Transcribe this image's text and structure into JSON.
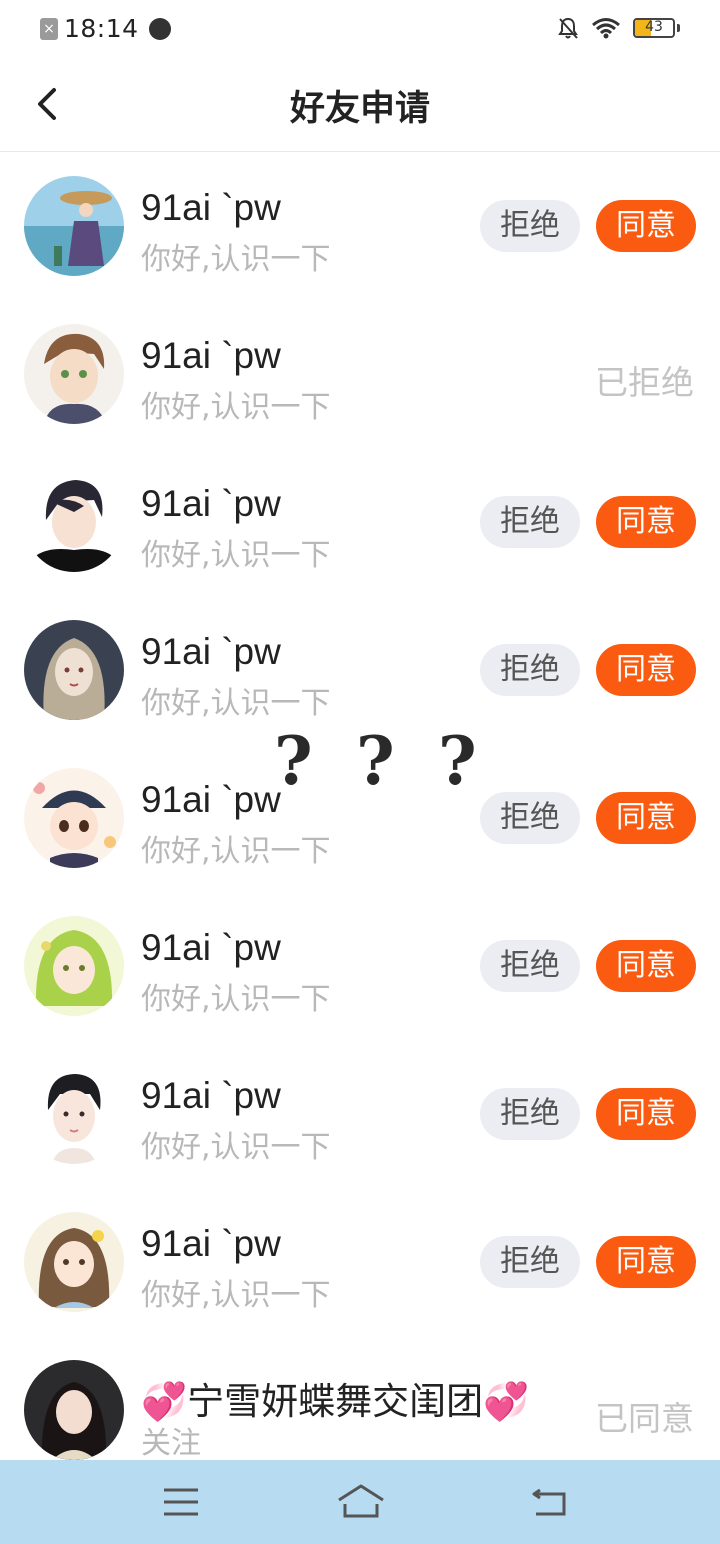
{
  "status_bar": {
    "time": "18:14",
    "notification_icon": "close-box-icon",
    "extra_icon": "speed-meter-icon",
    "mute_icon": "bell-off-icon",
    "wifi_icon": "wifi-icon",
    "battery_level": "43",
    "battery_fraction": 0.43,
    "battery_color": "#f2b51a"
  },
  "header": {
    "title": "好友申请",
    "back_icon": "chevron-left-icon"
  },
  "requests": [
    {
      "name": "91ai `pw",
      "message": "你好,认识一下",
      "reject_label": "拒绝",
      "accept_label": "同意",
      "avatar_icon": "girl-with-umbrella-avatar"
    },
    {
      "name": "91ai `pw",
      "message": "你好,认识一下",
      "status": "已拒绝",
      "avatar_icon": "anime-boy-avatar"
    },
    {
      "name": "91ai `pw",
      "message": "你好,认识一下",
      "reject_label": "拒绝",
      "accept_label": "同意",
      "avatar_icon": "dark-hair-man-avatar"
    },
    {
      "name": "91ai `pw",
      "message": "你好,认识一下",
      "reject_label": "拒绝",
      "accept_label": "同意",
      "avatar_icon": "anime-woman-avatar"
    },
    {
      "name": "91ai `pw",
      "message": "你好,认识一下",
      "reject_label": "拒绝",
      "accept_label": "同意",
      "avatar_icon": "chibi-girl-cap-avatar"
    },
    {
      "name": "91ai `pw",
      "message": "你好,认识一下",
      "reject_label": "拒绝",
      "accept_label": "同意",
      "avatar_icon": "green-hair-girl-avatar"
    },
    {
      "name": "91ai `pw",
      "message": "你好,认识一下",
      "reject_label": "拒绝",
      "accept_label": "同意",
      "avatar_icon": "anime-boy-black-hair-avatar"
    },
    {
      "name": "91ai `pw",
      "message": "你好,认识一下",
      "reject_label": "拒绝",
      "accept_label": "同意",
      "avatar_icon": "girl-with-flower-avatar"
    },
    {
      "name_prefix": "💞",
      "name": "宁雪妍蝶舞交闺团",
      "name_suffix": "💞",
      "message": "关注",
      "status": "已同意",
      "avatar_icon": "woman-photo-avatar"
    }
  ],
  "overlay": {
    "question_marks": [
      "?",
      "?",
      "?"
    ]
  },
  "nav_bar": {
    "menu_icon": "menu-icon",
    "home_icon": "home-icon",
    "back_icon": "return-icon",
    "color": "#b7dcf2"
  },
  "colors": {
    "accept": "#fb5b10",
    "reject_bg": "#ebedf2",
    "secondary_text": "#b8b8b8"
  }
}
